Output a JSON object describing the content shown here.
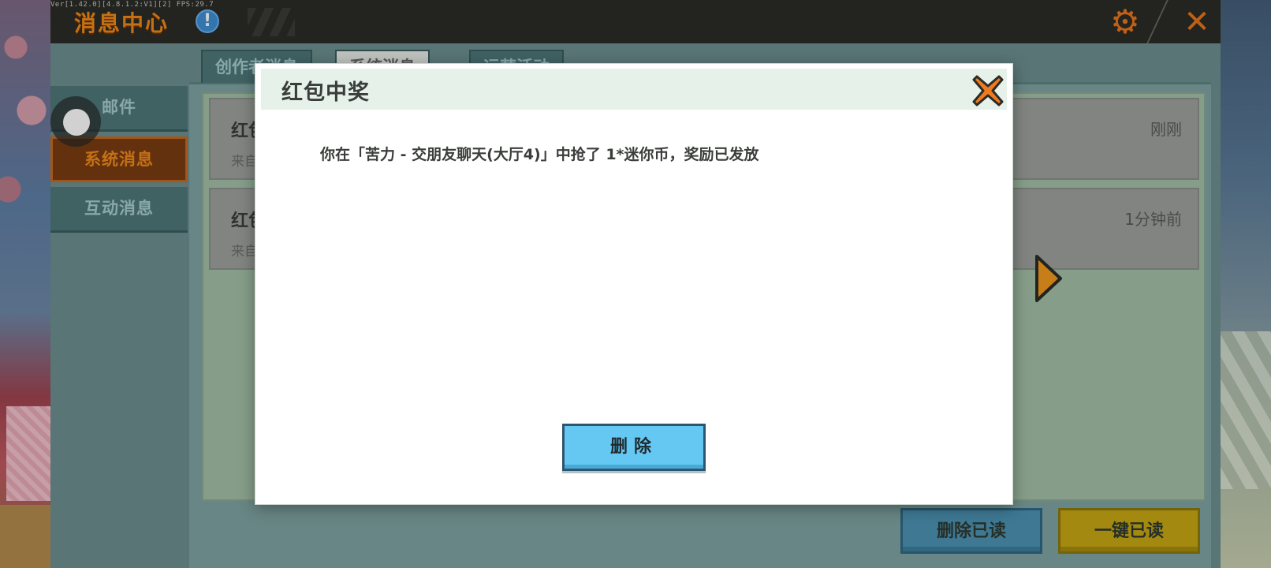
{
  "header": {
    "version": "Ver[1.42.0][4.8.1.2:V1][2] FPS:29.7",
    "title": "消息中心",
    "info_icon": "exclamation-icon",
    "info_glyph": "!",
    "settings_icon": "gear-icon",
    "settings_glyph": "⚙",
    "close_icon": "close-icon",
    "close_glyph": "✕"
  },
  "sidebar": {
    "items": [
      {
        "label": "邮件"
      },
      {
        "label": "系统消息",
        "active": true
      },
      {
        "label": "互动消息"
      }
    ]
  },
  "tabs": [
    {
      "label": "创作者消息"
    },
    {
      "label": "系统消息",
      "active": true
    },
    {
      "label": "运营活动"
    }
  ],
  "messages": [
    {
      "title": "红包中奖",
      "from": "来自",
      "time": "刚刚"
    },
    {
      "title": "红包中奖",
      "from": "来自",
      "time": "1分钟前"
    }
  ],
  "buttons": {
    "delete_read": "删除已读",
    "read_all": "一键已读"
  },
  "modal": {
    "title": "红包中奖",
    "body": "你在「苦力 - 交朋友聊天(大厅4)」中抢了 1*迷你币，奖励已发放",
    "delete_label": "删除",
    "close_icon": "close-icon"
  },
  "colors": {
    "accent_orange": "#f08a1c",
    "panel_teal": "#6d8f90",
    "modal_header": "#e6f1ea",
    "delete_blue": "#65c8f2",
    "read_all_yellow": "#c7a814"
  }
}
